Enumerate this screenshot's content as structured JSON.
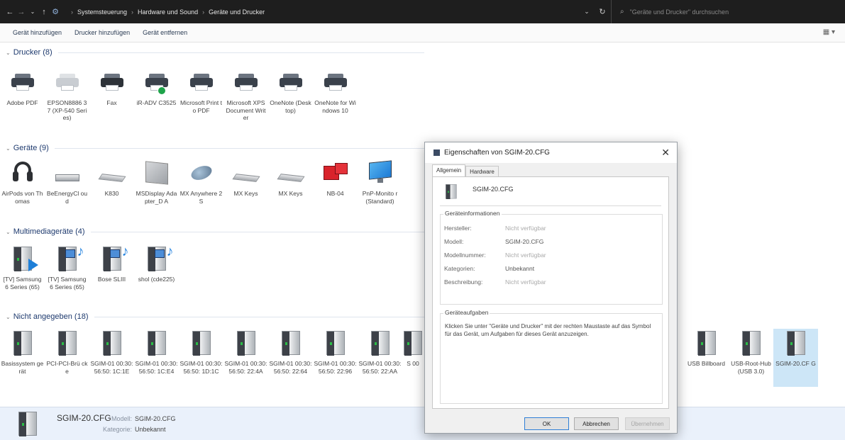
{
  "addressbar": {
    "breadcrumbs": [
      "Systemsteuerung",
      "Hardware und Sound",
      "Geräte und Drucker"
    ],
    "search_placeholder": "\"Geräte und Drucker\" durchsuchen"
  },
  "toolbar": {
    "add_device": "Gerät hinzufügen",
    "add_printer": "Drucker hinzufügen",
    "remove_device": "Gerät entfernen"
  },
  "groups": {
    "printers": {
      "title": "Drucker (8)",
      "items": [
        "Adobe PDF",
        "EPSON8886 37 (XP-540 Series)",
        "Fax",
        "iR-ADV C3525",
        "Microsoft Print to PDF",
        "Microsoft XPS Document Writer",
        "OneNote (Desktop)",
        "OneNote for Windows 10"
      ]
    },
    "devices": {
      "title": "Geräte (9)",
      "items": [
        "AirPods von Thomas",
        "BeEnergyCl oud",
        "K830",
        "MSDisplay Adapter_D A",
        "MX Anywhere 2S",
        "MX Keys",
        "MX Keys",
        "NB-04",
        "PnP-Monito r (Standard)"
      ]
    },
    "multimedia": {
      "title": "Multimediageräte (4)",
      "items": [
        "[TV] Samsung 6 Series (65)",
        "[TV] Samsung 6 Series (65)",
        "Bose SLIII",
        "shol (cde225)"
      ]
    },
    "unspecified": {
      "title": "Nicht angegeben (18)",
      "items": [
        "Basissystem gerät",
        "PCI-PCI-Brü cke",
        "SGIM-01 00:30:56:50: 1C:1E",
        "SGIM-01 00:30:56:50: 1C:E4",
        "SGIM-01 00:30:56:50: 1D:1C",
        "SGIM-01 00:30:56:50: 22:4A",
        "SGIM-01 00:30:56:50: 22:64",
        "SGIM-01 00:30:56:50: 22:96",
        "SGIM-01 00:30:56:50: 22:AA",
        "S 00"
      ],
      "right_items": [
        "USB Billboard",
        "USB-Root-Hub (USB 3.0)",
        "SGIM-20.CF G"
      ]
    }
  },
  "details": {
    "name": "SGIM-20.CFG",
    "model_key": "Modell:",
    "model_val": "SGIM-20.CFG",
    "category_key": "Kategorie:",
    "category_val": "Unbekannt"
  },
  "dialog": {
    "title": "Eigenschaften von SGIM-20.CFG",
    "tabs": [
      "Allgemein",
      "Hardware"
    ],
    "device_name": "SGIM-20.CFG",
    "info_legend": "Geräteinformationen",
    "info": [
      {
        "k": "Hersteller:",
        "v": "Nicht verfügbar"
      },
      {
        "k": "Modell:",
        "v": "SGIM-20.CFG"
      },
      {
        "k": "Modellnummer:",
        "v": "Nicht verfügbar"
      },
      {
        "k": "Kategorien:",
        "v": "Unbekannt"
      },
      {
        "k": "Beschreibung:",
        "v": "Nicht verfügbar"
      }
    ],
    "tasks_legend": "Geräteaufgaben",
    "tasks_text": "Klicken Sie unter \"Geräte und Drucker\" mit der rechten Maustaste auf das Symbol für das Gerät, um Aufgaben für dieses Gerät anzuzeigen.",
    "ok": "OK",
    "cancel": "Abbrechen",
    "apply": "Übernehmen"
  }
}
